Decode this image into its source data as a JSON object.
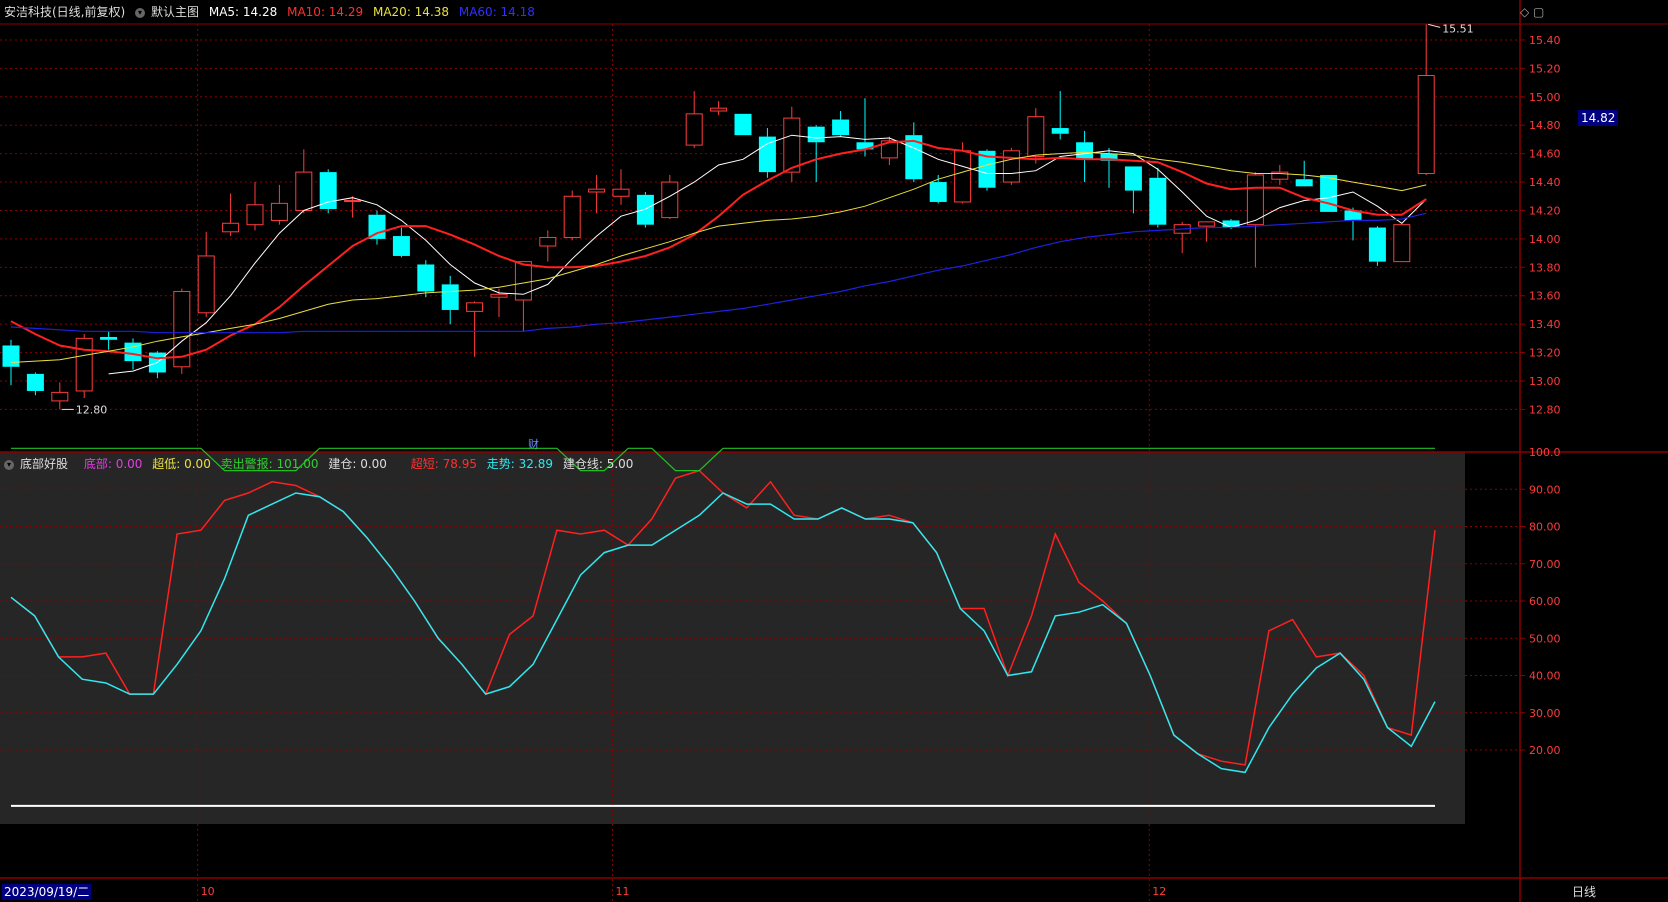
{
  "header_top": {
    "title": "安洁科技(日线,前复权)",
    "template": "默认主图",
    "ma5": "MA5: 14.28",
    "ma10": "MA10: 14.29",
    "ma20": "MA20: 14.38",
    "ma60": "MA60: 14.18"
  },
  "header_bottom": {
    "indicator": "底部好股",
    "dibu": "底部: 0.00",
    "chaodi": "超低: 0.00",
    "maichu": "卖出警报: 101.00",
    "jiancang": "建仓: 0.00",
    "chaoduan": "超短: 78.95",
    "zoushi": "走势: 32.89",
    "jiancangxian": "建仓线: 5.00"
  },
  "footer": {
    "date": "2023/09/19/二",
    "period": "日线"
  },
  "annotations": {
    "low_label": "12.80",
    "high_label": "15.51",
    "current_price": "14.82",
    "cai": "财"
  },
  "colors": {
    "up": "#ff3c3c",
    "down": "#00ffff",
    "ma5": "#ffffff",
    "ma10": "#ff2020",
    "ma20": "#e8e040",
    "ma60": "#2020e0",
    "chaoduan": "#ff2020",
    "zoushi": "#30e8f0",
    "maichu": "#20c020",
    "jiancangxian": "#ffffff",
    "grid": "#8b0000"
  },
  "chart_data": [
    {
      "type": "candlestick",
      "name": "price",
      "ylim": [
        12.7,
        15.55
      ],
      "yticks": [
        "12.80",
        "13.00",
        "13.20",
        "13.40",
        "13.60",
        "13.80",
        "14.00",
        "14.20",
        "14.40",
        "14.60",
        "14.80",
        "15.00",
        "15.20",
        "15.40"
      ],
      "x_month_labels": [
        {
          "index": 8,
          "label": "10"
        },
        {
          "index": 25,
          "label": "11"
        },
        {
          "index": 47,
          "label": "12"
        }
      ],
      "ohlc": [
        [
          13.25,
          13.29,
          12.97,
          13.1
        ],
        [
          13.05,
          13.06,
          12.9,
          12.93
        ],
        [
          12.86,
          12.99,
          12.8,
          12.92
        ],
        [
          12.93,
          13.33,
          12.88,
          13.3
        ],
        [
          13.31,
          13.35,
          13.22,
          13.29
        ],
        [
          13.27,
          13.3,
          13.08,
          13.14
        ],
        [
          13.2,
          13.21,
          13.02,
          13.06
        ],
        [
          13.1,
          13.65,
          13.05,
          13.63
        ],
        [
          13.48,
          14.05,
          13.45,
          13.88
        ],
        [
          14.05,
          14.32,
          14.02,
          14.11
        ],
        [
          14.1,
          14.4,
          14.06,
          14.24
        ],
        [
          14.13,
          14.38,
          14.1,
          14.25
        ],
        [
          14.2,
          14.63,
          14.18,
          14.47
        ],
        [
          14.47,
          14.49,
          14.18,
          14.21
        ],
        [
          14.27,
          14.3,
          14.15,
          14.27
        ],
        [
          14.17,
          14.2,
          13.96,
          14.0
        ],
        [
          14.02,
          14.08,
          13.87,
          13.88
        ],
        [
          13.82,
          13.85,
          13.59,
          13.63
        ],
        [
          13.68,
          13.74,
          13.4,
          13.5
        ],
        [
          13.49,
          13.56,
          13.17,
          13.55
        ],
        [
          13.59,
          13.65,
          13.45,
          13.61
        ],
        [
          13.57,
          13.84,
          13.35,
          13.84
        ],
        [
          13.95,
          14.06,
          13.84,
          14.01
        ],
        [
          14.01,
          14.34,
          13.99,
          14.3
        ],
        [
          14.33,
          14.45,
          14.18,
          14.35
        ],
        [
          14.3,
          14.49,
          14.24,
          14.35
        ],
        [
          14.31,
          14.33,
          14.08,
          14.1
        ],
        [
          14.15,
          14.45,
          14.14,
          14.4
        ],
        [
          14.66,
          15.04,
          14.64,
          14.88
        ],
        [
          14.9,
          14.97,
          14.87,
          14.92
        ],
        [
          14.88,
          14.88,
          14.73,
          14.73
        ],
        [
          14.72,
          14.78,
          14.43,
          14.47
        ],
        [
          14.47,
          14.93,
          14.4,
          14.85
        ],
        [
          14.79,
          14.8,
          14.4,
          14.68
        ],
        [
          14.84,
          14.9,
          14.72,
          14.73
        ],
        [
          14.68,
          14.99,
          14.58,
          14.63
        ],
        [
          14.57,
          14.72,
          14.52,
          14.69
        ],
        [
          14.73,
          14.82,
          14.4,
          14.42
        ],
        [
          14.4,
          14.45,
          14.25,
          14.26
        ],
        [
          14.26,
          14.68,
          14.25,
          14.62
        ],
        [
          14.62,
          14.63,
          14.34,
          14.36
        ],
        [
          14.4,
          14.64,
          14.38,
          14.62
        ],
        [
          14.58,
          14.92,
          14.53,
          14.86
        ],
        [
          14.78,
          15.04,
          14.7,
          14.74
        ],
        [
          14.68,
          14.76,
          14.4,
          14.56
        ],
        [
          14.6,
          14.64,
          14.36,
          14.55
        ],
        [
          14.51,
          14.51,
          14.18,
          14.34
        ],
        [
          14.43,
          14.5,
          14.08,
          14.1
        ],
        [
          14.04,
          14.12,
          13.9,
          14.1
        ],
        [
          14.09,
          14.12,
          13.98,
          14.12
        ],
        [
          14.13,
          14.14,
          14.07,
          14.08
        ],
        [
          14.1,
          14.47,
          13.8,
          14.45
        ],
        [
          14.42,
          14.52,
          14.38,
          14.47
        ],
        [
          14.42,
          14.55,
          14.38,
          14.37
        ],
        [
          14.45,
          14.45,
          14.19,
          14.19
        ],
        [
          14.2,
          14.22,
          13.99,
          14.13
        ],
        [
          14.08,
          14.09,
          13.81,
          13.84
        ],
        [
          13.84,
          14.1,
          13.84,
          14.1
        ],
        [
          14.46,
          15.51,
          14.45,
          15.15
        ]
      ],
      "series": [
        {
          "name": "MA5",
          "values": [
            null,
            null,
            null,
            null,
            13.05,
            13.07,
            13.13,
            13.28,
            13.41,
            13.6,
            13.83,
            14.04,
            14.2,
            14.26,
            14.29,
            14.24,
            14.13,
            13.99,
            13.82,
            13.69,
            13.62,
            13.61,
            13.68,
            13.86,
            14.02,
            14.16,
            14.21,
            14.3,
            14.4,
            14.52,
            14.56,
            14.67,
            14.73,
            14.71,
            14.72,
            14.7,
            14.71,
            14.64,
            14.56,
            14.51,
            14.46,
            14.46,
            14.48,
            14.58,
            14.6,
            14.62,
            14.6,
            14.49,
            14.33,
            14.16,
            14.08,
            14.13,
            14.22,
            14.27,
            14.29,
            14.33,
            14.23,
            14.11,
            14.28
          ]
        },
        {
          "name": "MA10",
          "values": [
            13.42,
            13.33,
            13.25,
            13.22,
            13.21,
            13.19,
            13.16,
            13.17,
            13.22,
            13.32,
            13.4,
            13.52,
            13.67,
            13.81,
            13.95,
            14.04,
            14.09,
            14.09,
            14.03,
            13.96,
            13.88,
            13.82,
            13.8,
            13.8,
            13.81,
            13.84,
            13.88,
            13.94,
            14.03,
            14.16,
            14.31,
            14.41,
            14.5,
            14.56,
            14.6,
            14.63,
            14.68,
            14.69,
            14.64,
            14.62,
            14.58,
            14.57,
            14.56,
            14.57,
            14.56,
            14.56,
            14.55,
            14.54,
            14.47,
            14.39,
            14.35,
            14.36,
            14.36,
            14.29,
            14.25,
            14.2,
            14.17,
            14.17,
            14.28
          ]
        },
        {
          "name": "MA20",
          "values": [
            13.13,
            13.14,
            13.15,
            13.18,
            13.21,
            13.24,
            13.28,
            13.31,
            13.34,
            13.37,
            13.4,
            13.44,
            13.49,
            13.54,
            13.57,
            13.58,
            13.6,
            13.62,
            13.63,
            13.64,
            13.66,
            13.69,
            13.72,
            13.77,
            13.82,
            13.88,
            13.93,
            13.98,
            14.04,
            14.09,
            14.11,
            14.13,
            14.14,
            14.16,
            14.19,
            14.23,
            14.29,
            14.35,
            14.42,
            14.47,
            14.52,
            14.56,
            14.59,
            14.6,
            14.61,
            14.6,
            14.59,
            14.56,
            14.54,
            14.51,
            14.48,
            14.46,
            14.46,
            14.45,
            14.43,
            14.4,
            14.37,
            14.34,
            14.38
          ]
        },
        {
          "name": "MA60",
          "values": [
            13.38,
            13.37,
            13.36,
            13.35,
            13.35,
            13.35,
            13.34,
            13.34,
            13.34,
            13.34,
            13.34,
            13.34,
            13.35,
            13.35,
            13.35,
            13.35,
            13.35,
            13.35,
            13.35,
            13.35,
            13.35,
            13.35,
            13.37,
            13.38,
            13.4,
            13.41,
            13.43,
            13.45,
            13.47,
            13.49,
            13.51,
            13.54,
            13.57,
            13.6,
            13.63,
            13.67,
            13.7,
            13.74,
            13.78,
            13.81,
            13.85,
            13.89,
            13.94,
            13.98,
            14.01,
            14.03,
            14.05,
            14.06,
            14.07,
            14.08,
            14.08,
            14.09,
            14.1,
            14.11,
            14.12,
            14.13,
            14.13,
            14.14,
            14.18
          ]
        }
      ]
    },
    {
      "type": "line",
      "name": "indicator",
      "ylim": [
        0,
        102
      ],
      "yticks": [
        "20.00",
        "30.00",
        "40.00",
        "50.00",
        "60.00",
        "70.00",
        "80.00",
        "90.00",
        "100.0"
      ],
      "series": [
        {
          "name": "超短",
          "values": [
            61,
            56,
            45,
            45,
            46,
            35,
            35,
            78,
            79,
            87,
            89,
            92,
            91,
            88,
            84,
            77,
            69,
            60,
            50,
            43,
            35,
            51,
            56,
            79,
            78,
            79,
            75,
            82,
            93,
            95,
            89,
            85,
            92,
            83,
            82,
            85,
            82,
            83,
            81,
            73,
            58,
            58,
            40,
            56,
            78,
            65,
            60,
            54,
            40,
            24,
            19,
            17,
            16,
            52,
            55,
            45,
            46,
            40,
            26,
            24,
            79
          ]
        },
        {
          "name": "走势",
          "values": [
            61,
            56,
            45,
            39,
            38,
            35,
            35,
            43,
            52,
            66,
            83,
            86,
            89,
            88,
            84,
            77,
            69,
            60,
            50,
            43,
            35,
            37,
            43,
            55,
            67,
            73,
            75,
            75,
            79,
            83,
            89,
            86,
            86,
            82,
            82,
            85,
            82,
            82,
            81,
            73,
            58,
            52,
            40,
            41,
            56,
            57,
            59,
            54,
            40,
            24,
            19,
            15,
            14,
            26,
            35,
            42,
            46,
            39,
            26,
            21,
            33
          ]
        },
        {
          "name": "卖出警报",
          "values": [
            101,
            101,
            101,
            101,
            101,
            101,
            101,
            101,
            101,
            95,
            95,
            95,
            95,
            101,
            101,
            101,
            101,
            101,
            101,
            101,
            101,
            101,
            101,
            101,
            95,
            95,
            101,
            101,
            95,
            95,
            101,
            101,
            101,
            101,
            101,
            101,
            101,
            101,
            101,
            101,
            101,
            101,
            101,
            101,
            101,
            101,
            101,
            101,
            101,
            101,
            101,
            101,
            101,
            101,
            101,
            101,
            101,
            101,
            101,
            101,
            101
          ]
        },
        {
          "name": "建仓线",
          "values": [
            5,
            5,
            5,
            5,
            5,
            5,
            5,
            5,
            5,
            5,
            5,
            5,
            5,
            5,
            5,
            5,
            5,
            5,
            5,
            5,
            5,
            5,
            5,
            5,
            5,
            5,
            5,
            5,
            5,
            5,
            5,
            5,
            5,
            5,
            5,
            5,
            5,
            5,
            5,
            5,
            5,
            5,
            5,
            5,
            5,
            5,
            5,
            5,
            5,
            5,
            5,
            5,
            5,
            5,
            5,
            5,
            5,
            5,
            5,
            5,
            5
          ]
        }
      ]
    }
  ]
}
